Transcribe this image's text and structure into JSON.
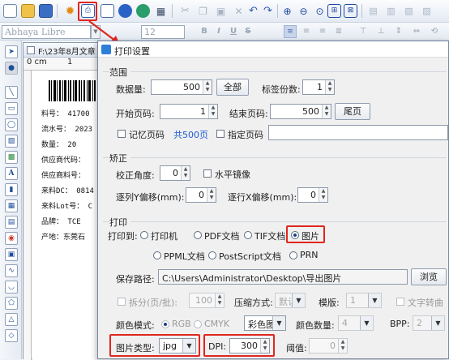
{
  "toolbar": {
    "font_name": "Abhaya Libre",
    "font_size": "12",
    "format": {
      "bold": "B",
      "italic": "I",
      "underline": "U",
      "strike": "S"
    }
  },
  "document": {
    "tab_title": "F:\\23年8月文章",
    "ruler_label": "0 cm",
    "ruler_tick": "1",
    "label_lines": [
      "料号： 41700",
      "流水号： 2023",
      "数量： 20",
      "供应商代码：",
      "供应商料号：",
      "来料DC： 0814",
      "来料Lot号： C",
      "品牌： TCE",
      "产地：东莞石"
    ]
  },
  "dialog": {
    "title": "打印设置",
    "range": {
      "group_label": "范围",
      "quantity_label": "数据量:",
      "quantity_value": "500",
      "all_button": "全部",
      "copies_label": "标签份数:",
      "copies_value": "1",
      "start_label": "开始页码:",
      "start_value": "1",
      "end_label": "结束页码:",
      "end_value": "500",
      "last_button": "尾页",
      "remember_label": "记忆页码",
      "total_pages": "共500页",
      "specify_label": "指定页码"
    },
    "correction": {
      "group_label": "矫正",
      "angle_label": "校正角度:",
      "angle_value": "0",
      "mirror_label": "水平镜像",
      "offset_y_label": "逐列Y偏移(mm):",
      "offset_y_value": "0",
      "offset_x_label": "逐行X偏移(mm):",
      "offset_x_value": "0"
    },
    "print": {
      "group_label": "打印",
      "print_to_label": "打印到:",
      "options": [
        "打印机",
        "PDF文档",
        "TIF文档",
        "图片",
        "PPML文档",
        "PostScript文档",
        "PRN"
      ],
      "selected": "图片",
      "save_path_label": "保存路径:",
      "save_path_value": "C:\\Users\\Administrator\\Desktop\\导出图片",
      "browse_button": "浏览",
      "split_label": "拆分(页/批):",
      "split_value": "100",
      "compression_label": "压缩方式:",
      "compression_value": "默认",
      "template_label": "模版:",
      "template_value": "1",
      "text_convert_label": "文字转曲",
      "color_mode_label": "颜色模式:",
      "color_rgb": "RGB",
      "color_cmyk": "CMYK",
      "color_value": "彩色图",
      "color_count_label": "颜色数量:",
      "color_count_value": "4",
      "bpp_label": "BPP:",
      "bpp_value": "2",
      "image_type_label": "图片类型:",
      "image_type_value": "jpg",
      "dpi_label": "DPI:",
      "dpi_value": "300",
      "threshold_label": "阈值:",
      "threshold_value": "0"
    }
  },
  "colors": {
    "highlight": "#e0261f",
    "link_blue": "#1f5bd6",
    "arrow_red": "#e0261f"
  }
}
